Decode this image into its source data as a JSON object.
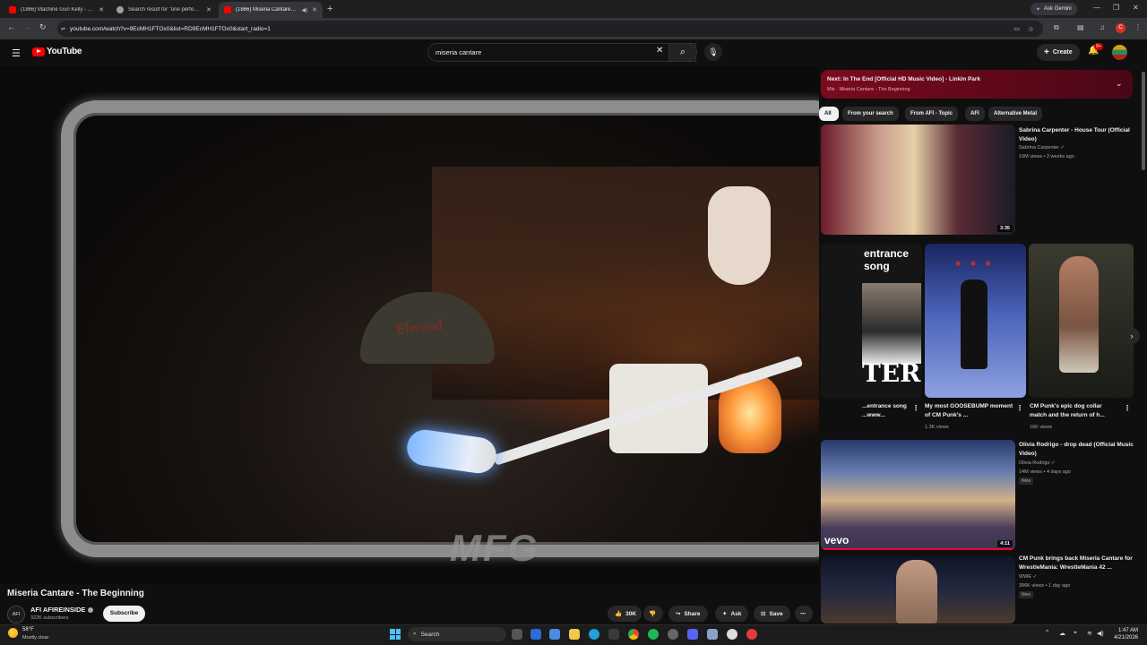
{
  "browser": {
    "tabs": [
      {
        "title": "(1866) Machine Gun Kelly - pro",
        "favicon_color": "#ff0000",
        "active": false
      },
      {
        "title": "Search result for \"one perfect d",
        "favicon_color": "#9aa0a6",
        "active": false
      },
      {
        "title": "(1866) Miseria Cantare - Th",
        "favicon_color": "#ff0000",
        "active": true
      }
    ],
    "new_tab_label": "+",
    "gemini_label": "Ask Gemini",
    "url": "youtube.com/watch?v=9EcMH1FTOx0&list=RD9EcMH1FTOx0&start_radio=1",
    "profile_initial": "C"
  },
  "youtube": {
    "logo_text": "YouTube",
    "search_value": "miseria cantare",
    "create_label": "Create",
    "notification_count": "9+"
  },
  "video": {
    "watermark": "MFG",
    "cap_text": "Elwood",
    "title": "Miseria Cantare - The Beginning",
    "channel_avatar_text": "AFI",
    "channel_name": "AFI AFIREINSIDE",
    "subscribers": "322K subscribers",
    "subscribe_label": "Subscribe",
    "like_count": "30K",
    "share_label": "Share",
    "ask_label": "Ask",
    "save_label": "Save"
  },
  "next_up": {
    "title": "Next: In The End [Official HD Music Video] - Linkin Park",
    "subtitle": "Mix · Miseria Cantare - The Beginning"
  },
  "chips": [
    "All",
    "From your search",
    "From AFI - Topic",
    "AFI",
    "Alternative Metal"
  ],
  "recommendations": [
    {
      "title": "Sabrina Carpenter - House Tour (Official Video)",
      "channel": "Sabrina Carpenter",
      "meta": "19M views • 2 weeks ago",
      "duration": "3:35"
    },
    {
      "title": "Olivia Rodrigo - drop dead (Official Music Video)",
      "channel": "Olivia Rodrigo",
      "meta": "14M views • 4 days ago",
      "badge": "New",
      "duration": "4:11",
      "thumb_text": "vevo"
    },
    {
      "title": "CM Punk brings back Miseria Cantare for WrestleMania: WrestleMania 42 ...",
      "channel": "WWE",
      "meta": "396K views • 1 day ago",
      "badge": "New"
    }
  ],
  "shorts": [
    {
      "title": "...entrance song ...www...",
      "overlay_top": "entrance song",
      "overlay_bottom": "TER"
    },
    {
      "title": "My most GOOSEBUMP moment of CM Punk's ...",
      "views": "1.3K views"
    },
    {
      "title": "CM Punk's epic dog collar match and the return of h...",
      "views": "16K views"
    }
  ],
  "taskbar": {
    "temperature": "58°F",
    "weather": "Mostly clear",
    "search_label": "Search",
    "time": "1:47 AM",
    "date": "4/21/2026"
  }
}
